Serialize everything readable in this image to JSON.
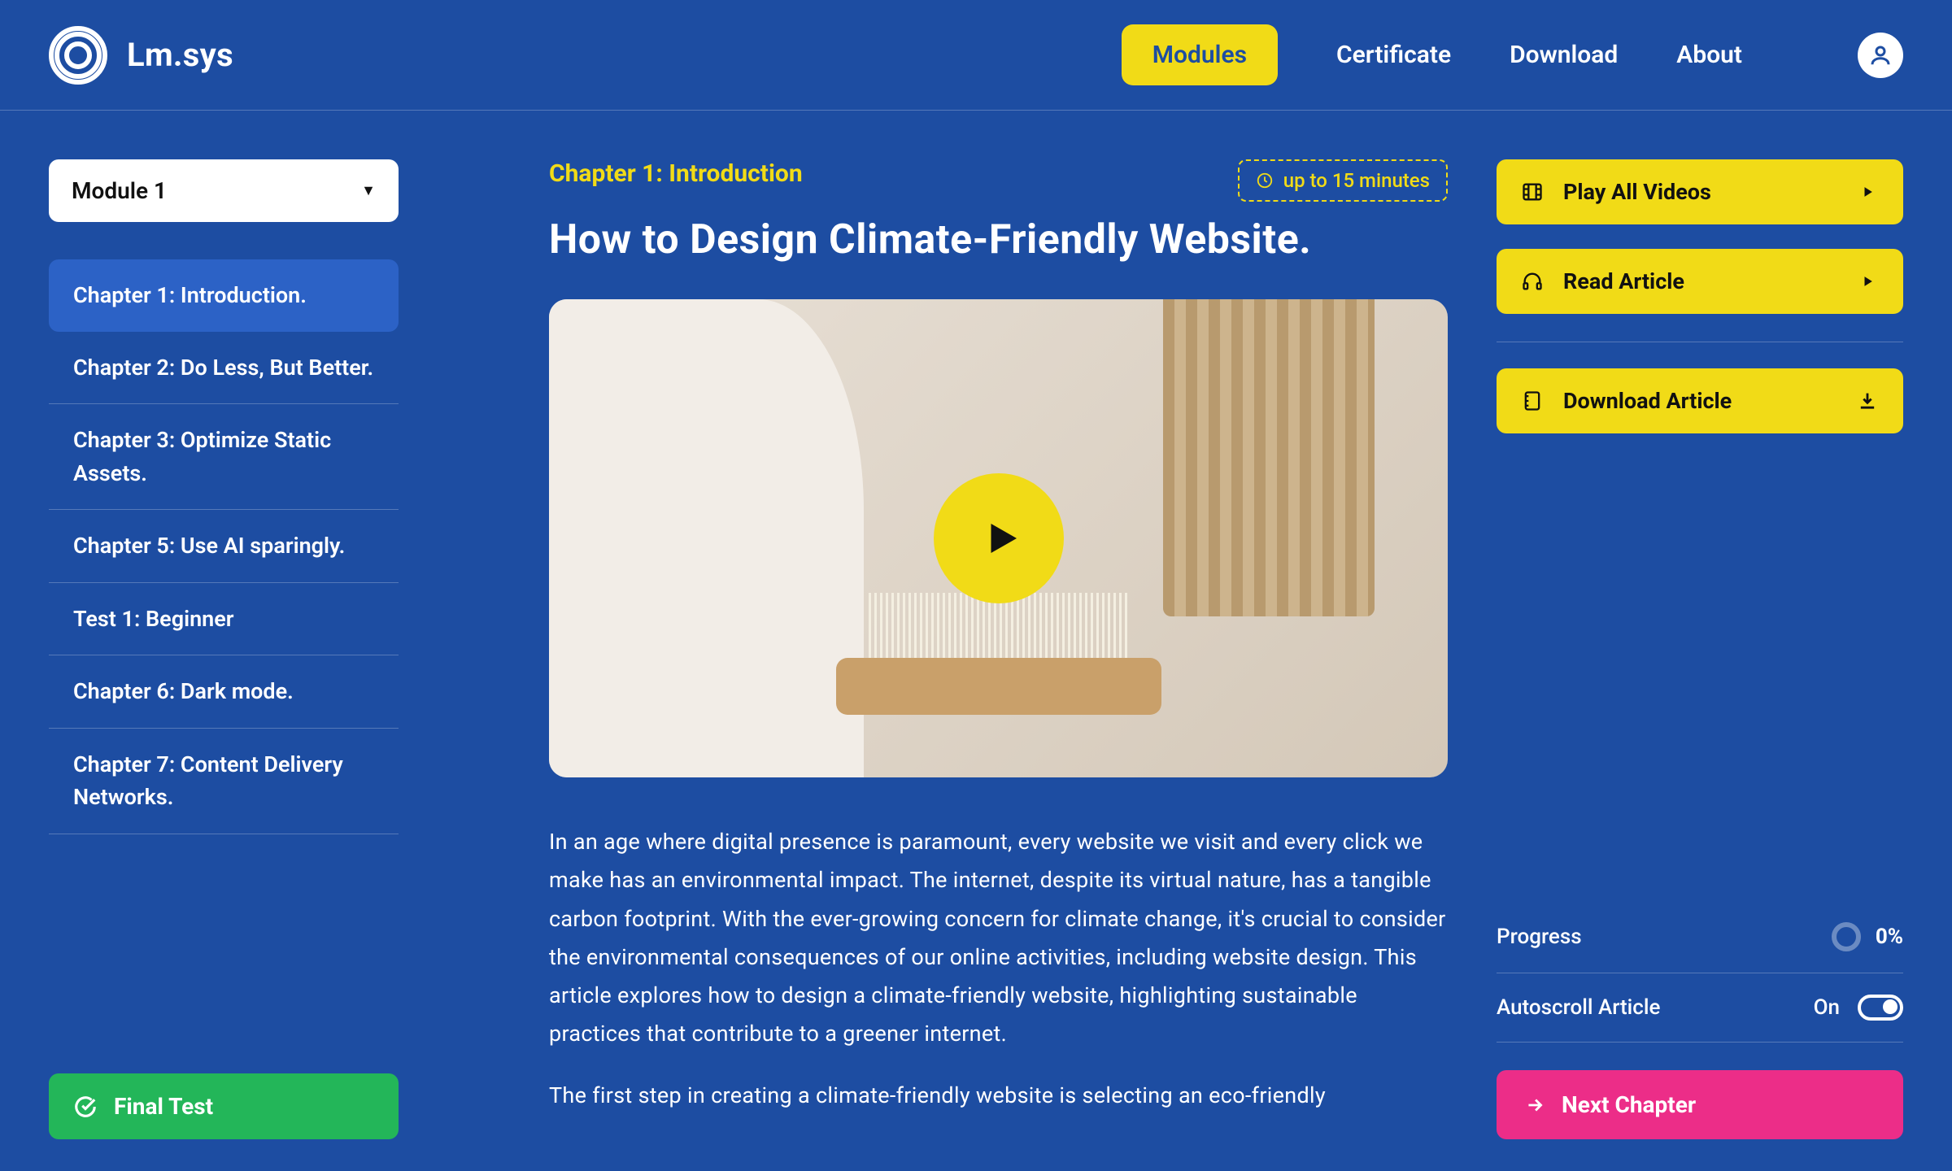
{
  "brand": {
    "name": "Lm.sys"
  },
  "nav": {
    "items": [
      {
        "label": "Modules",
        "active": true
      },
      {
        "label": "Certificate",
        "active": false
      },
      {
        "label": "Download",
        "active": false
      },
      {
        "label": "About",
        "active": false
      }
    ]
  },
  "sidebar": {
    "module_selector_value": "Module 1",
    "chapters": [
      {
        "label": "Chapter 1: Introduction.",
        "active": true
      },
      {
        "label": "Chapter 2: Do Less, But Better.",
        "active": false
      },
      {
        "label": "Chapter 3: Optimize Static Assets.",
        "active": false
      },
      {
        "label": "Chapter 5: Use AI sparingly.",
        "active": false
      },
      {
        "label": "Test 1: Beginner",
        "active": false
      },
      {
        "label": "Chapter 6: Dark mode.",
        "active": false
      },
      {
        "label": "Chapter 7: Content Delivery Networks.",
        "active": false
      }
    ],
    "final_test_label": "Final Test"
  },
  "main": {
    "chapter_label": "Chapter 1: Introduction",
    "time_badge": "up to 15 minutes",
    "title": "How to Design Climate-Friendly Website.",
    "paragraph1": "In an age where digital presence is paramount, every website we visit and every click we make has an environmental impact. The internet, despite its virtual nature, has a tangible carbon footprint. With the ever-growing concern for climate change, it's crucial to consider the environmental consequences of our online activities, including website design. This article explores how to design a climate-friendly website, highlighting sustainable practices that contribute to a greener internet.",
    "paragraph2": "The first step in creating a climate-friendly website is selecting an eco-friendly"
  },
  "rightcol": {
    "play_all_label": "Play All Videos",
    "read_article_label": "Read Article",
    "download_article_label": "Download Article",
    "progress_label": "Progress",
    "progress_value": "0%",
    "autoscroll_label": "Autoscroll Article",
    "autoscroll_state": "On",
    "next_chapter_label": "Next Chapter"
  },
  "colors": {
    "primary_bg": "#1d4da2",
    "accent_yellow": "#f1db17",
    "accent_green": "#23b659",
    "accent_pink": "#ec2d88"
  }
}
